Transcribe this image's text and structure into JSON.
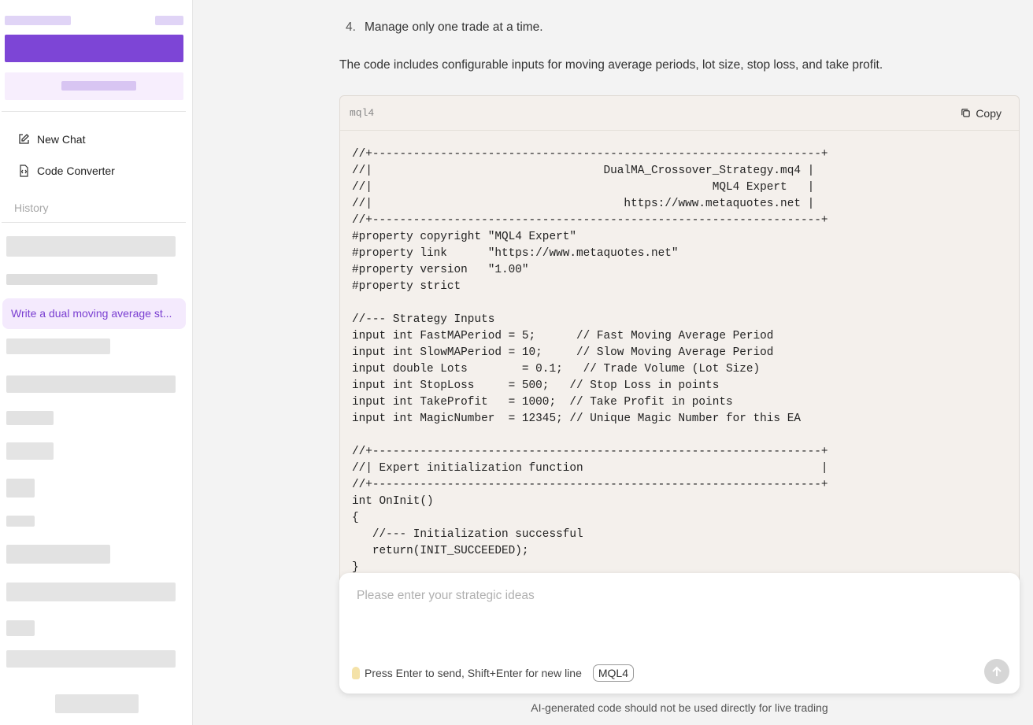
{
  "sidebar": {
    "nav": [
      {
        "label": "New Chat",
        "icon": "edit-icon"
      },
      {
        "label": "Code Converter",
        "icon": "code-file-icon"
      }
    ],
    "history_label": "History",
    "active_history_item": "Write a dual moving average st..."
  },
  "main": {
    "list_item_number": "4.",
    "list_item_text": "Manage only one trade at a time.",
    "paragraph": "The code includes configurable inputs for moving average periods, lot size, stop loss, and take profit.",
    "code_block": {
      "language": "mql4",
      "copy_label": "Copy",
      "lines": [
        "//+------------------------------------------------------------------+",
        "//|                                  DualMA_Crossover_Strategy.mq4 |",
        "//|                                                  MQL4 Expert   |",
        "//|                                     https://www.metaquotes.net |",
        "//+------------------------------------------------------------------+",
        "#property copyright \"MQL4 Expert\"",
        "#property link      \"https://www.metaquotes.net\"",
        "#property version   \"1.00\"",
        "#property strict",
        "",
        "//--- Strategy Inputs",
        "input int FastMAPeriod = 5;      // Fast Moving Average Period",
        "input int SlowMAPeriod = 10;     // Slow Moving Average Period",
        "input double Lots        = 0.1;   // Trade Volume (Lot Size)",
        "input int StopLoss     = 500;   // Stop Loss in points",
        "input int TakeProfit   = 1000;  // Take Profit in points",
        "input int MagicNumber  = 12345; // Unique Magic Number for this EA",
        "",
        "//+------------------------------------------------------------------+",
        "//| Expert initialization function                                   |",
        "//+------------------------------------------------------------------+",
        "int OnInit()",
        "{",
        "   //--- Initialization successful",
        "   return(INIT_SUCCEEDED);",
        "}"
      ]
    }
  },
  "composer": {
    "placeholder": "Please enter your strategic ideas",
    "hint": "Press Enter to send, Shift+Enter for new line",
    "language_badge": "MQL4",
    "disclaimer": "AI-generated code should not be used directly for live trading"
  },
  "colors": {
    "accent": "#7a3fd1",
    "active_bg": "#f4eafd",
    "code_bg": "#f4f0ec"
  }
}
